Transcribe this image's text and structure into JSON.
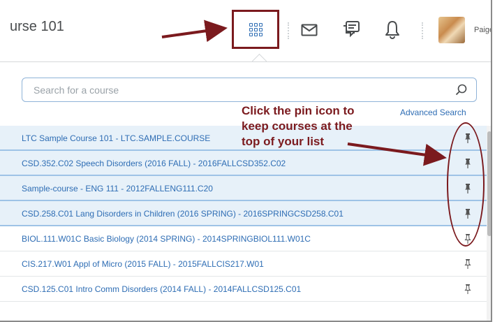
{
  "header": {
    "course_title": "urse 101",
    "user_name": "Paige"
  },
  "search": {
    "placeholder": "Search for a course",
    "advanced_search_label": "Advanced Search"
  },
  "courses": [
    {
      "label": "LTC Sample Course 101 - LTC.SAMPLE.COURSE",
      "pinned": true
    },
    {
      "label": "CSD.352.C02 Speech Disorders (2016 FALL) - 2016FALLCSD352.C02",
      "pinned": true
    },
    {
      "label": "Sample-course - ENG 111 - 2012FALLENG111.C20",
      "pinned": true
    },
    {
      "label": "CSD.258.C01 Lang Disorders in Children (2016 SPRING) - 2016SPRINGCSD258.C01",
      "pinned": true
    },
    {
      "label": "BIOL.111.W01C Basic Biology (2014 SPRING) - 2014SPRINGBIOL111.W01C",
      "pinned": false
    },
    {
      "label": "CIS.217.W01 Appl of Micro (2015 FALL) - 2015FALLCIS217.W01",
      "pinned": false
    },
    {
      "label": "CSD.125.C01 Intro Comm Disorders (2014 FALL) - 2014FALLCSD125.C01",
      "pinned": false
    }
  ],
  "annotation": {
    "line1": "Click the pin icon to",
    "line2": "keep courses at the",
    "line3": "top of your list"
  },
  "icons": {
    "waffle": "course-selector-icon",
    "mail": "mail-icon",
    "chat": "chat-icon",
    "bell": "bell-icon",
    "search": "search-icon",
    "pin": "pin-icon"
  },
  "colors": {
    "annotation": "#7b1a1e",
    "link": "#2e6db4",
    "pinned_row_bg": "#e7f1f9"
  }
}
